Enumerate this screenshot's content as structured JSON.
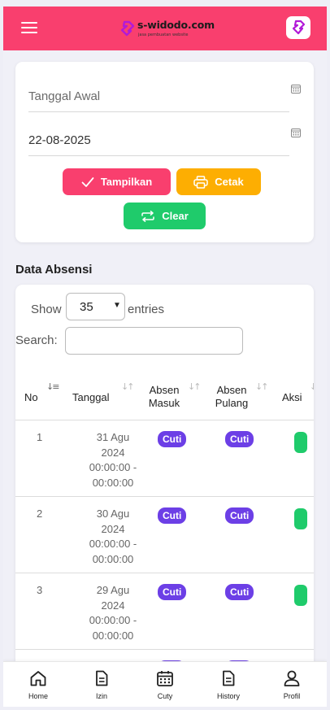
{
  "header": {
    "brand_name": "s-widodo.com",
    "brand_tagline": "jasa pembuatan website",
    "colors": {
      "primary": "#f93f6e",
      "text": "#1b1b1b"
    }
  },
  "filter": {
    "start_date_placeholder": "Tanggal Awal",
    "end_date_value": "22-08-2025",
    "buttons": {
      "show": "Tampilkan",
      "print": "Cetak",
      "clear": "Clear"
    },
    "colors": {
      "show": "#f93f6e",
      "print": "#fdae02",
      "clear": "#1fcb6b"
    }
  },
  "attendance": {
    "title": "Data Absensi",
    "show_label": "Show",
    "entries_value": "35",
    "entries_label": "entries",
    "search_label": "Search:",
    "columns": {
      "no": "No",
      "date": "Tanggal",
      "in_line1": "Absen",
      "in_line2": "Masuk",
      "out_line1": "Absen",
      "out_line2": "Pulang",
      "action": "Aksi"
    },
    "rows": [
      {
        "no": "1",
        "date_l1": "31 Agu",
        "date_l2": "2024",
        "date_l3": "00:00:00 -",
        "date_l4": "00:00:00",
        "in": "Cuti",
        "out": "Cuti"
      },
      {
        "no": "2",
        "date_l1": "30 Agu",
        "date_l2": "2024",
        "date_l3": "00:00:00 -",
        "date_l4": "00:00:00",
        "in": "Cuti",
        "out": "Cuti"
      },
      {
        "no": "3",
        "date_l1": "29 Agu",
        "date_l2": "2024",
        "date_l3": "00:00:00 -",
        "date_l4": "00:00:00",
        "in": "Cuti",
        "out": "Cuti"
      }
    ],
    "colors": {
      "badge": "#6c3fe6",
      "action": "#1fcb6b"
    }
  },
  "bottom_nav": {
    "items": [
      {
        "label": "Home",
        "icon": "home-icon"
      },
      {
        "label": "Izin",
        "icon": "document-icon"
      },
      {
        "label": "Cuty",
        "icon": "calendar-icon"
      },
      {
        "label": "History",
        "icon": "history-document-icon"
      },
      {
        "label": "Profil",
        "icon": "user-icon"
      }
    ]
  }
}
